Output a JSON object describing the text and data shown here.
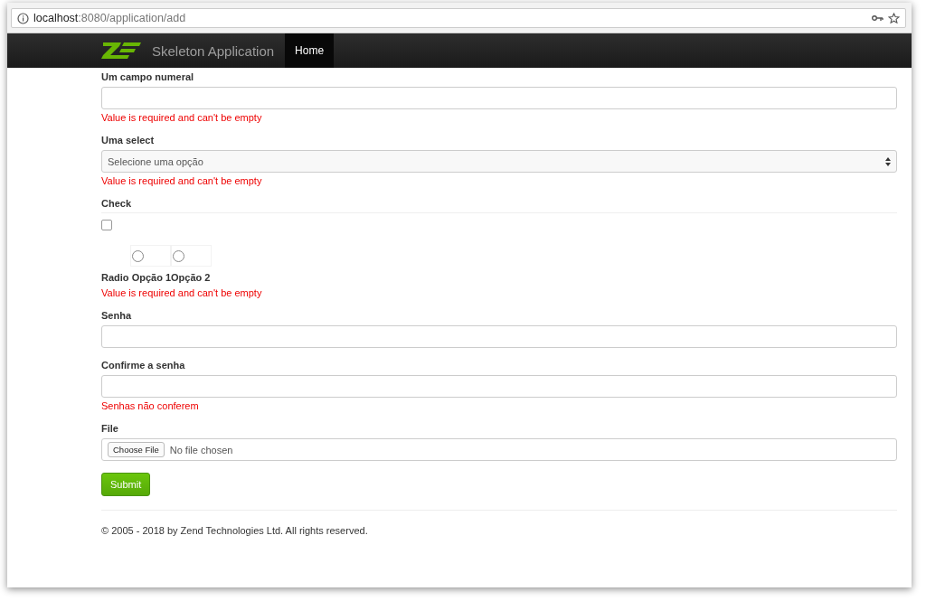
{
  "browser": {
    "url_host": "localhost",
    "url_path": ":8080/application/add"
  },
  "navbar": {
    "brand": "Skeleton Application",
    "items": [
      {
        "label": "Home",
        "selected": true
      }
    ]
  },
  "form": {
    "fields": [
      {
        "kind": "text",
        "label": "Um campo numeral",
        "error": "Value is required and can't be empty"
      },
      {
        "kind": "select",
        "label": "Uma select",
        "value": "Selecione uma opção",
        "error": "Value is required and can't be empty"
      },
      {
        "kind": "checkbox",
        "label": "Check",
        "checked": false
      },
      {
        "kind": "radio",
        "label": "Radio",
        "options": [
          {
            "label": "Opção 1",
            "selected": false
          },
          {
            "label": "Opção 2",
            "selected": false
          }
        ],
        "error": "Value is required and can't be empty"
      },
      {
        "kind": "password",
        "label": "Senha"
      },
      {
        "kind": "password",
        "label": "Confirme a senha",
        "error": "Senhas não conferem"
      },
      {
        "kind": "file",
        "label": "File",
        "button": "Choose File",
        "value": "No file chosen"
      }
    ],
    "submit": "Submit"
  },
  "footer": "© 2005 - 2018 by Zend Technologies Ltd. All rights reserved."
}
